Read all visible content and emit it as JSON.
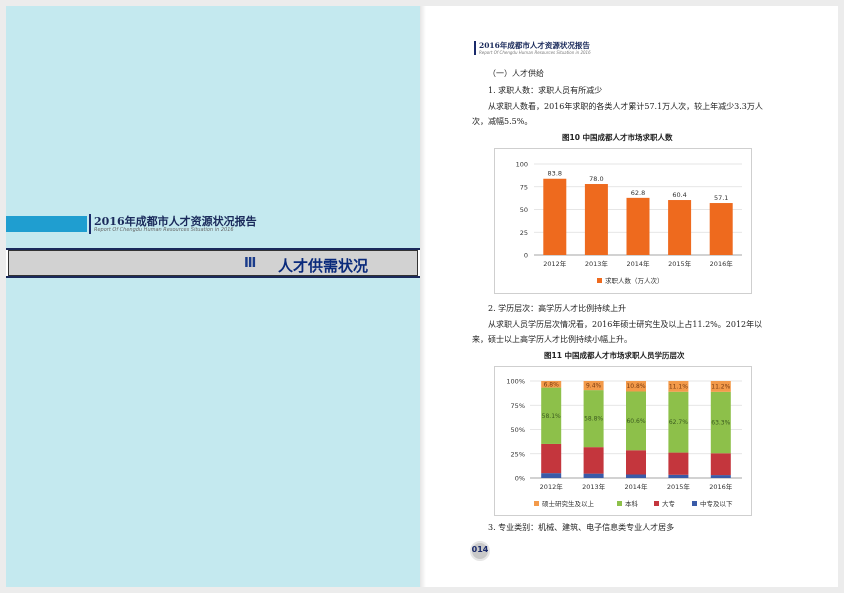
{
  "left_page": {
    "report_title": "2016年成都市人才资源状况报告",
    "report_subtitle": "Report Of Chengdu Human Resources Situation in 2016",
    "section_number": "Ⅲ",
    "section_title": "人才供需状况"
  },
  "right_page": {
    "header_title": "2016年成都市人才资源状况报告",
    "header_subtitle": "Report Of Chengdu Human Resources Situation in 2016",
    "section_heading": "（一）人才供给",
    "item1_heading": "1. 求职人数：求职人员有所减少",
    "para1_line1": "从求职人数看，2016年求职的各类人才累计57.1万人次，较上年减少3.3万人",
    "para1_line2": "次，减幅5.5%。",
    "fig10_title": "图10    中国成都人才市场求职人数",
    "item2_heading": "2. 学历层次：高学历人才比例持续上升",
    "para2_line1": "从求职人员学历层次情况看，2016年硕士研究生及以上占11.2%。2012年以",
    "para2_line2": "来，硕士以上高学历人才比例持续小幅上升。",
    "fig11_title": "图11    中国成都人才市场求职人员学历层次",
    "item3_heading": "3. 专业类别：机械、建筑、电子信息类专业人才居多",
    "page_number": "014"
  },
  "chart_data": [
    {
      "type": "bar",
      "title": "图10    中国成都人才市场求职人数",
      "categories": [
        "2012年",
        "2013年",
        "2014年",
        "2015年",
        "2016年"
      ],
      "series": [
        {
          "name": "求职人数（万人次）",
          "values": [
            83.8,
            78.0,
            62.8,
            60.4,
            57.1
          ]
        }
      ],
      "data_labels": [
        "83.8",
        "78.0",
        "62.8",
        "60.4",
        "57.1"
      ],
      "yticks": [
        "0",
        "25",
        "50",
        "75",
        "100"
      ],
      "ylim": [
        0,
        100
      ],
      "grid": true,
      "legend": "bottom",
      "color": "#ee6a1e"
    },
    {
      "type": "bar",
      "stacked": true,
      "title": "图11    中国成都人才市场求职人员学历层次",
      "categories": [
        "2012年",
        "2013年",
        "2014年",
        "2015年",
        "2016年"
      ],
      "series": [
        {
          "name": "中专及以下",
          "values": [
            5.0,
            4.5,
            3.6,
            3.3,
            3.0
          ],
          "color": "#3a5ba8"
        },
        {
          "name": "大专",
          "values": [
            30.1,
            27.3,
            25.0,
            22.9,
            22.5
          ],
          "color": "#c4363d"
        },
        {
          "name": "本科",
          "values": [
            58.1,
            58.8,
            60.6,
            62.7,
            63.3
          ],
          "color": "#8dc04a"
        },
        {
          "name": "硕士研究生及以上",
          "values": [
            6.8,
            9.4,
            10.8,
            11.1,
            11.2
          ],
          "color": "#f39a4a"
        }
      ],
      "top_labels": [
        "6.8%",
        "9.4%",
        "10.8%",
        "11.1%",
        "11.2%"
      ],
      "mid_labels": [
        "58.1%",
        "58.8%",
        "60.6%",
        "62.7%",
        "63.3%"
      ],
      "yticks": [
        "0%",
        "25%",
        "50%",
        "75%",
        "100%"
      ],
      "ylim": [
        0,
        100
      ],
      "grid": true,
      "legend": "bottom"
    }
  ]
}
